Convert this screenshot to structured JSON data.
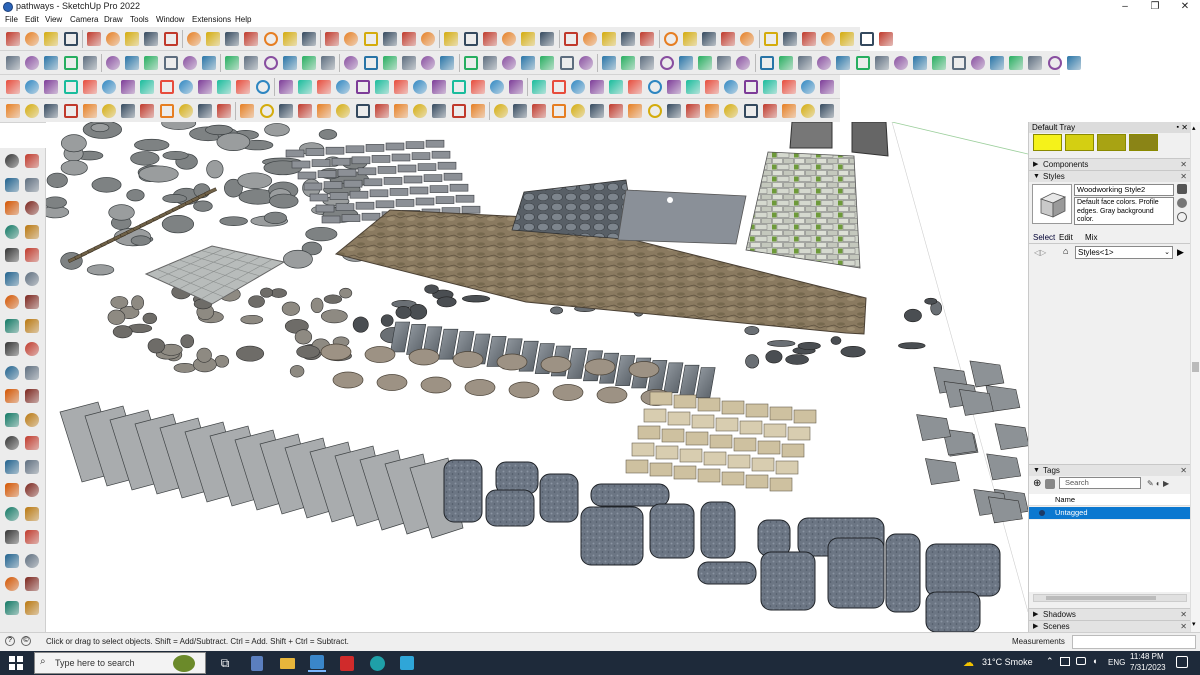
{
  "window": {
    "title": "pathways - SketchUp Pro 2022",
    "minimize": "–",
    "maximize": "❐",
    "close": "✕"
  },
  "menu": [
    "File",
    "Edit",
    "View",
    "Camera",
    "Draw",
    "Tools",
    "Window",
    "Extensions",
    "Help"
  ],
  "tray": {
    "title": "Default Tray",
    "swatch_colors": [
      "#f5f21a",
      "#d4cf12",
      "#a8a313",
      "#8a8416"
    ],
    "components_label": "Components",
    "styles_label": "Styles",
    "style_name": "Woodworking Style2",
    "style_description": "Default face colors. Profile edges. Gray background color.",
    "tabs": [
      "Select",
      "Edit",
      "Mix"
    ],
    "style_dropdown": "Styles<1>",
    "tags_label": "Tags",
    "tags_search_placeholder": "Search",
    "tags_column": "Name",
    "tag_row": "Untagged",
    "shadows_label": "Shadows",
    "scenes_label": "Scenes"
  },
  "status": {
    "hint": "Click or drag to select objects. Shift = Add/Subtract. Ctrl = Add. Shift + Ctrl = Subtract.",
    "measurements_label": "Measurements"
  },
  "taskbar": {
    "search_placeholder": "Type here to search",
    "weather": "31°C  Smoke",
    "language": "ENG",
    "time": "11:48 PM",
    "date": "7/31/2023"
  }
}
